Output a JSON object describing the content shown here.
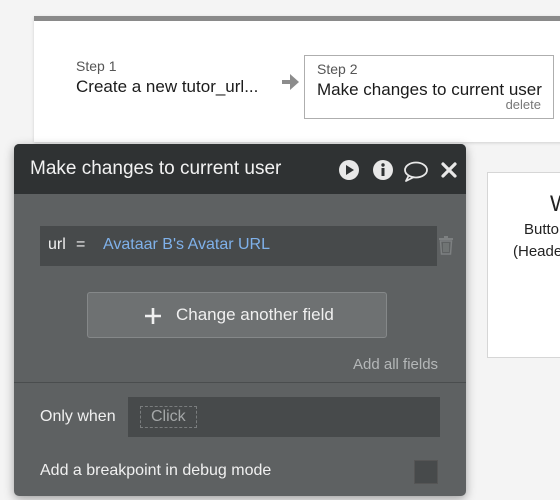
{
  "workflow": {
    "step1": {
      "label": "Step 1",
      "title": "Create a new tutor_url..."
    },
    "step2": {
      "label": "Step 2",
      "title": "Make changes to current user",
      "delete_label": "delete"
    }
  },
  "side_element": {
    "big_text": "W",
    "line1": "Butto",
    "line2": "(Heade"
  },
  "dialog": {
    "title": "Make changes to current user",
    "icons": [
      "play-icon",
      "info-icon",
      "comment-icon",
      "close-icon"
    ],
    "field": {
      "name": "url",
      "operator": "=",
      "value": "Avataar B's Avatar URL"
    },
    "change_button_label": "Change another field",
    "add_all_label": "Add all fields",
    "only_when_label": "Only when",
    "only_when_placeholder": "Click",
    "breakpoint_label": "Add a breakpoint in debug mode"
  },
  "colors": {
    "dialog_bg": "#5e6162",
    "header_bg": "#2f3233",
    "field_value": "#7fb1ea"
  }
}
